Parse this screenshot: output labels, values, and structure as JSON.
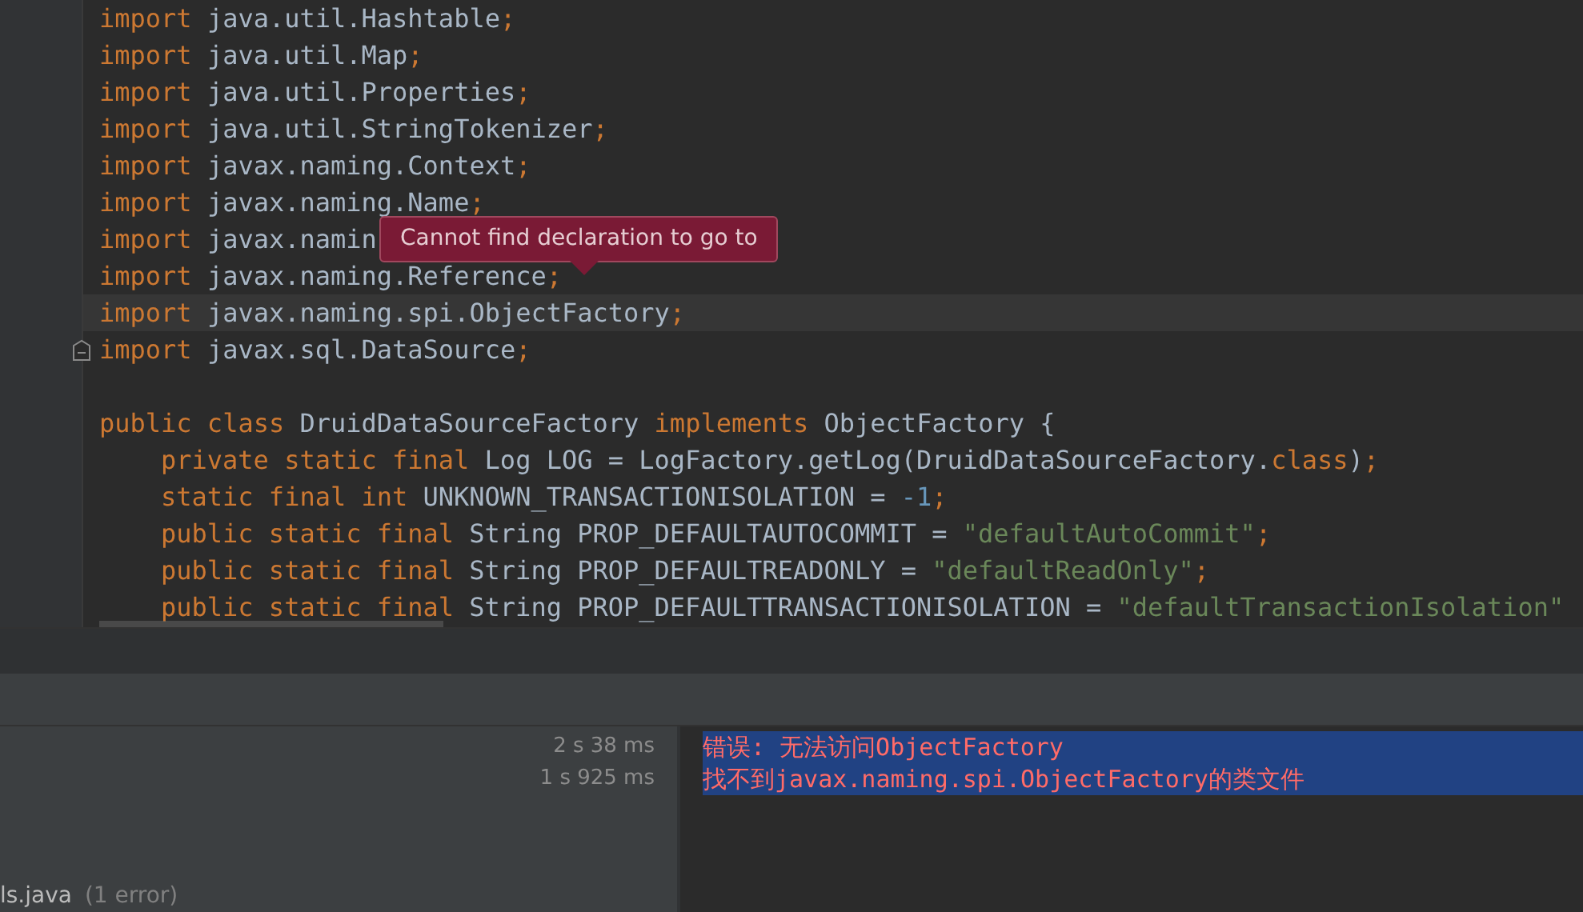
{
  "editor": {
    "lines": [
      {
        "current": false,
        "fold": false,
        "tokens": [
          {
            "kind": "kw",
            "text": "import "
          },
          {
            "kind": "plain",
            "text": "java.util.Hashtable"
          },
          {
            "kind": "semi",
            "text": ";"
          }
        ]
      },
      {
        "current": false,
        "fold": false,
        "tokens": [
          {
            "kind": "kw",
            "text": "import "
          },
          {
            "kind": "plain",
            "text": "java.util.Map"
          },
          {
            "kind": "semi",
            "text": ";"
          }
        ]
      },
      {
        "current": false,
        "fold": false,
        "tokens": [
          {
            "kind": "kw",
            "text": "import "
          },
          {
            "kind": "plain",
            "text": "java.util.Properties"
          },
          {
            "kind": "semi",
            "text": ";"
          }
        ]
      },
      {
        "current": false,
        "fold": false,
        "tokens": [
          {
            "kind": "kw",
            "text": "import "
          },
          {
            "kind": "plain",
            "text": "java.util.StringTokenizer"
          },
          {
            "kind": "semi",
            "text": ";"
          }
        ]
      },
      {
        "current": false,
        "fold": false,
        "tokens": [
          {
            "kind": "kw",
            "text": "import "
          },
          {
            "kind": "plain",
            "text": "javax.naming.Context"
          },
          {
            "kind": "semi",
            "text": ";"
          }
        ]
      },
      {
        "current": false,
        "fold": false,
        "tokens": [
          {
            "kind": "kw",
            "text": "import "
          },
          {
            "kind": "plain",
            "text": "javax.naming.Name"
          },
          {
            "kind": "semi",
            "text": ";"
          }
        ]
      },
      {
        "current": false,
        "fold": false,
        "tokens": [
          {
            "kind": "kw",
            "text": "import "
          },
          {
            "kind": "plain",
            "text": "javax.namin"
          }
        ]
      },
      {
        "current": false,
        "fold": false,
        "tokens": [
          {
            "kind": "kw",
            "text": "import "
          },
          {
            "kind": "plain",
            "text": "javax.naming.Reference"
          },
          {
            "kind": "semi",
            "text": ";"
          }
        ]
      },
      {
        "current": true,
        "fold": false,
        "tokens": [
          {
            "kind": "kw",
            "text": "import "
          },
          {
            "kind": "plain",
            "text": "javax.naming.spi.ObjectFactory"
          },
          {
            "kind": "semi",
            "text": ";"
          }
        ]
      },
      {
        "current": false,
        "fold": true,
        "tokens": [
          {
            "kind": "kw",
            "text": "import "
          },
          {
            "kind": "plain",
            "text": "javax.sql.DataSource"
          },
          {
            "kind": "semi",
            "text": ";"
          }
        ]
      },
      {
        "current": false,
        "fold": false
      },
      {
        "current": false,
        "fold": false,
        "tokens": [
          {
            "kind": "kw",
            "text": "public class "
          },
          {
            "kind": "plain",
            "text": "DruidDataSourceFactory "
          },
          {
            "kind": "kw",
            "text": "implements "
          },
          {
            "kind": "plain",
            "text": "ObjectFactory {"
          }
        ],
        "children": [
          {
            "current": false,
            "fold": false,
            "tokens": [
              {
                "kind": "kw",
                "text": "private static final "
              },
              {
                "kind": "plain",
                "text": "Log LOG = LogFactory.getLog(DruidDataSourceFactory."
              },
              {
                "kind": "kw",
                "text": "class"
              },
              {
                "kind": "plain",
                "text": ")"
              },
              {
                "kind": "semi",
                "text": ";"
              }
            ]
          },
          {
            "current": false,
            "fold": false,
            "tokens": [
              {
                "kind": "kw",
                "text": "static final int "
              },
              {
                "kind": "plain",
                "text": "UNKNOWN_TRANSACTIONISOLATION = "
              },
              {
                "kind": "num",
                "text": "-1"
              },
              {
                "kind": "semi",
                "text": ";"
              }
            ]
          },
          {
            "current": false,
            "fold": false,
            "tokens": [
              {
                "kind": "kw",
                "text": "public static final "
              },
              {
                "kind": "plain",
                "text": "String PROP_DEFAULTAUTOCOMMIT = "
              },
              {
                "kind": "str",
                "text": "\"defaultAutoCommit\""
              },
              {
                "kind": "semi",
                "text": ";"
              }
            ]
          },
          {
            "current": false,
            "fold": false,
            "tokens": [
              {
                "kind": "kw",
                "text": "public static final "
              },
              {
                "kind": "plain",
                "text": "String PROP_DEFAULTREADONLY = "
              },
              {
                "kind": "str",
                "text": "\"defaultReadOnly\""
              },
              {
                "kind": "semi",
                "text": ";"
              }
            ]
          },
          {
            "current": false,
            "fold": false,
            "tokens": [
              {
                "kind": "kw",
                "text": "public static final "
              },
              {
                "kind": "plain",
                "text": "String PROP_DEFAULTTRANSACTIONISOLATION = "
              },
              {
                "kind": "str",
                "text": "\"defaultTransactionIsolation\""
              }
            ]
          }
        ]
      }
    ],
    "tooltip": "Cannot find declaration to go to"
  },
  "build": {
    "tasks": [
      {
        "time": "2 s 38 ms"
      },
      {
        "time": "1 s 925 ms"
      }
    ],
    "file": {
      "name": "ls.java",
      "count": "(1 error)"
    },
    "messages": [
      {
        "text": "错误: 无法访问ObjectFactory",
        "selected": true
      },
      {
        "text": "找不到javax.naming.spi.ObjectFactory的类文件",
        "selected": true
      }
    ]
  }
}
